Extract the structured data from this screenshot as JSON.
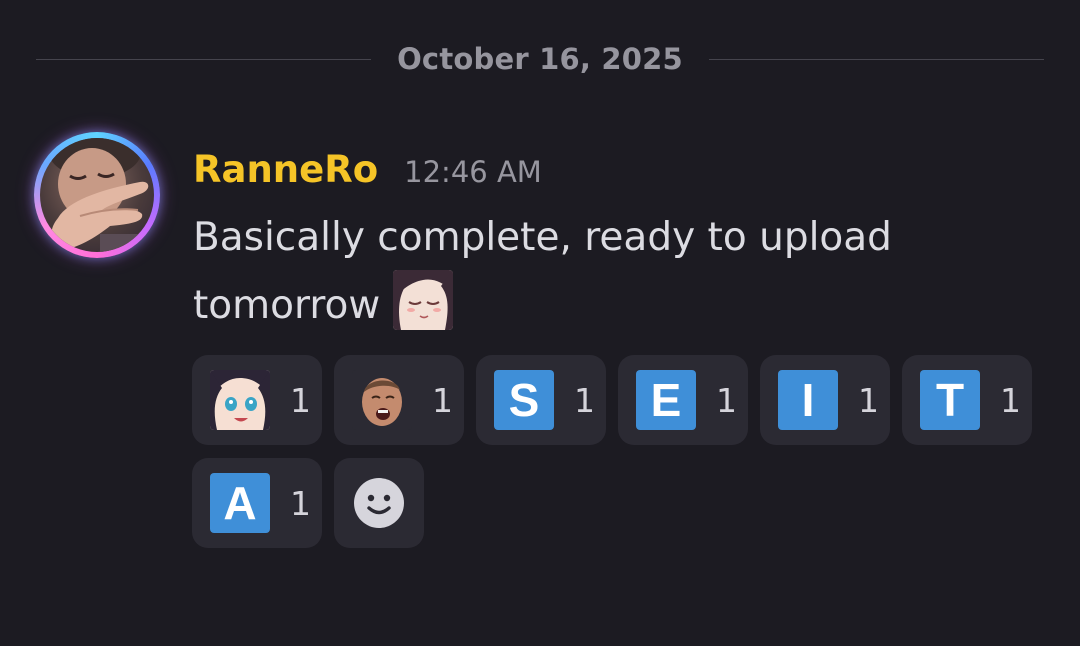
{
  "divider": {
    "date": "October 16, 2025"
  },
  "message": {
    "username": "RanneRo",
    "timestamp": "12:46 AM",
    "text": "Basically complete, ready to upload tomorrow",
    "username_color": "#f5c427",
    "inline_emoji": "anime-girl-smile-emoji"
  },
  "reactions": [
    {
      "emoji": "anime-girl-emoji",
      "count": "1"
    },
    {
      "emoji": "laughing-man-emoji",
      "count": "1"
    },
    {
      "emoji": "regional-indicator",
      "letter": "S",
      "count": "1"
    },
    {
      "emoji": "regional-indicator",
      "letter": "E",
      "count": "1"
    },
    {
      "emoji": "regional-indicator",
      "letter": "I",
      "count": "1"
    },
    {
      "emoji": "regional-indicator",
      "letter": "T",
      "count": "1"
    },
    {
      "emoji": "regional-indicator",
      "letter": "A",
      "count": "1"
    }
  ],
  "add_reaction": {
    "icon": "smiley-add-reaction-icon"
  },
  "colors": {
    "background": "#1c1b22",
    "reaction_bg": "#2b2a33",
    "letter_emoji_bg": "#3f8fd8"
  }
}
